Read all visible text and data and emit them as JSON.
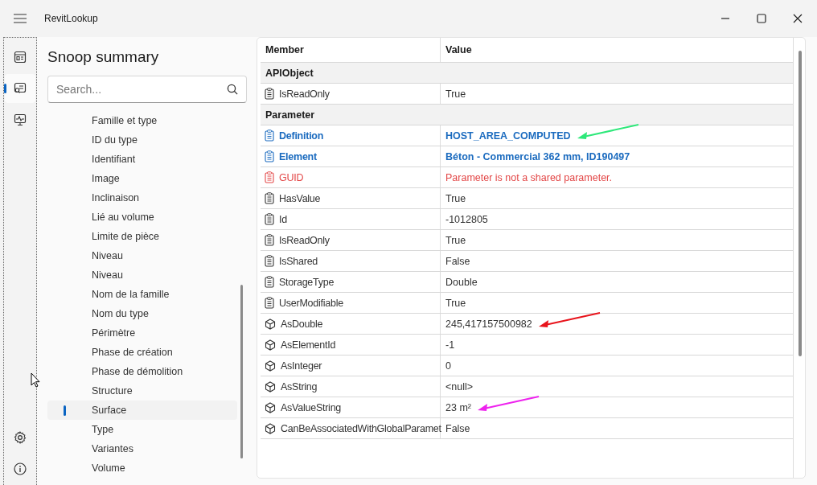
{
  "window": {
    "title": "RevitLookup"
  },
  "rail": {
    "items": [
      {
        "kind": "dashboard",
        "selected": false
      },
      {
        "kind": "snoop",
        "selected": true
      },
      {
        "kind": "monitor",
        "selected": false
      }
    ],
    "footer": [
      {
        "kind": "settings"
      },
      {
        "kind": "info"
      }
    ]
  },
  "page_title": "Snoop summary",
  "search": {
    "placeholder": "Search..."
  },
  "tree": {
    "items": [
      {
        "label": "Famille et type",
        "selected": false
      },
      {
        "label": "ID du type",
        "selected": false
      },
      {
        "label": "Identifiant",
        "selected": false
      },
      {
        "label": "Image",
        "selected": false
      },
      {
        "label": "Inclinaison",
        "selected": false
      },
      {
        "label": "Lié au volume",
        "selected": false
      },
      {
        "label": "Limite de pièce",
        "selected": false
      },
      {
        "label": "Niveau",
        "selected": false
      },
      {
        "label": "Niveau",
        "selected": false
      },
      {
        "label": "Nom de la famille",
        "selected": false
      },
      {
        "label": "Nom du type",
        "selected": false
      },
      {
        "label": "Périmètre",
        "selected": false
      },
      {
        "label": "Phase de création",
        "selected": false
      },
      {
        "label": "Phase de démolition",
        "selected": false
      },
      {
        "label": "Structure",
        "selected": false
      },
      {
        "label": "Surface",
        "selected": true
      },
      {
        "label": "Type",
        "selected": false
      },
      {
        "label": "Variantes",
        "selected": false
      },
      {
        "label": "Volume",
        "selected": false
      }
    ]
  },
  "table": {
    "columns": [
      "Member",
      "Value"
    ],
    "rows": [
      {
        "kind": "group",
        "member": "APIObject"
      },
      {
        "kind": "property",
        "member": "IsReadOnly",
        "value": "True"
      },
      {
        "kind": "group",
        "member": "Parameter"
      },
      {
        "kind": "link_property",
        "member": "Definition",
        "value": "HOST_AREA_COMPUTED",
        "arrow": {
          "color": "#2ee87a"
        }
      },
      {
        "kind": "link_property",
        "member": "Element",
        "value": "Béton - Commercial 362 mm, ID190497"
      },
      {
        "kind": "error_property",
        "member": "GUID",
        "value": "Parameter is not a shared parameter."
      },
      {
        "kind": "property",
        "member": "HasValue",
        "value": "True"
      },
      {
        "kind": "property",
        "member": "Id",
        "value": "-1012805"
      },
      {
        "kind": "property",
        "member": "IsReadOnly",
        "value": "True"
      },
      {
        "kind": "property",
        "member": "IsShared",
        "value": "False"
      },
      {
        "kind": "property",
        "member": "StorageType",
        "value": "Double"
      },
      {
        "kind": "property",
        "member": "UserModifiable",
        "value": "True"
      },
      {
        "kind": "method",
        "member": "AsDouble",
        "value": "245,417157500982",
        "arrow": {
          "color": "#e8141c"
        }
      },
      {
        "kind": "method",
        "member": "AsElementId",
        "value": "-1"
      },
      {
        "kind": "method",
        "member": "AsInteger",
        "value": "0"
      },
      {
        "kind": "method",
        "member": "AsString",
        "value": "<null>"
      },
      {
        "kind": "method",
        "member": "AsValueString",
        "value": "23 m²",
        "arrow": {
          "color": "#ee22ee"
        }
      },
      {
        "kind": "method",
        "member": "CanBeAssociatedWithGlobalParamet",
        "value": "False"
      }
    ]
  }
}
